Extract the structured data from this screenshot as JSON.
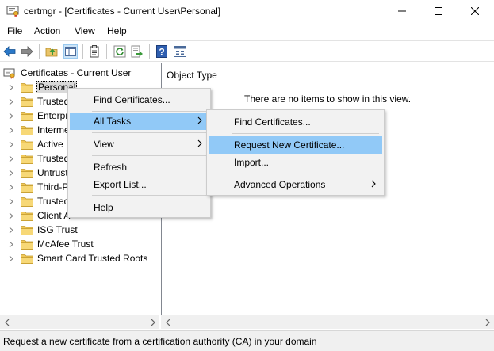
{
  "window": {
    "title": "certmgr - [Certificates - Current User\\Personal]",
    "accent": "#0078d7"
  },
  "menubar": [
    "File",
    "Action",
    "View",
    "Help"
  ],
  "toolbar": {
    "icons": [
      "back-arrow-icon",
      "forward-arrow-icon",
      "up-folder-icon",
      "show-hide-console-tree-icon",
      "properties-icon",
      "refresh-icon",
      "export-list-icon",
      "help-icon",
      "mmc-view-icon"
    ]
  },
  "tree": {
    "root": "Certificates - Current User",
    "items": [
      {
        "label": "Personal",
        "selected": true
      },
      {
        "label": "Trusted"
      },
      {
        "label": "Enterpr"
      },
      {
        "label": "Interme"
      },
      {
        "label": "Active I"
      },
      {
        "label": "Trusted"
      },
      {
        "label": "Untrust"
      },
      {
        "label": "Third-P"
      },
      {
        "label": "Trusted"
      },
      {
        "label": "Client A"
      },
      {
        "label": "ISG Trust"
      },
      {
        "label": "McAfee Trust"
      },
      {
        "label": "Smart Card Trusted Roots"
      }
    ]
  },
  "right_pane": {
    "column_header": "Object Type",
    "empty_message": "There are no items to show in this view."
  },
  "context_menu": {
    "items": [
      "Find Certificates...",
      "All Tasks",
      "View",
      "Refresh",
      "Export List...",
      "Help"
    ],
    "highlight_color": "#91c9f7"
  },
  "submenu": {
    "items": [
      "Find Certificates...",
      "Request New Certificate...",
      "Import...",
      "Advanced Operations"
    ]
  },
  "status": {
    "text": "Request a new certificate from a certification authority (CA) in your domain"
  }
}
